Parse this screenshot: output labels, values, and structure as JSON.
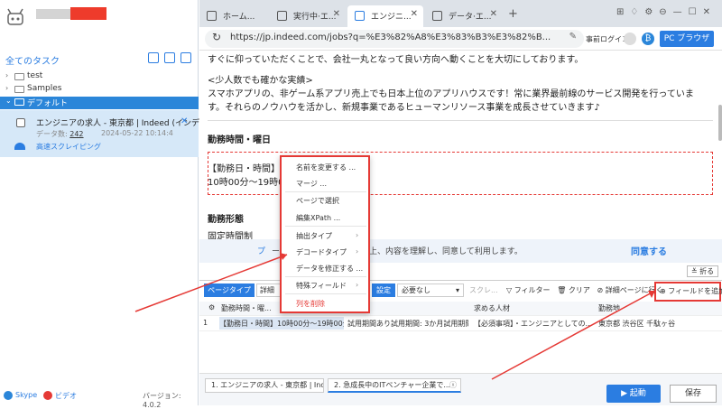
{
  "app": {
    "version": "バージョン: 4.0.2",
    "all_tasks": "全てのタスク"
  },
  "tree": [
    {
      "label": "test"
    },
    {
      "label": "Samples"
    },
    {
      "label": "デフォルト"
    }
  ],
  "task": {
    "name": "エンジニアの求人 - 東京都 | Indeed (インデ...",
    "count_label": "データ数:",
    "count": "242",
    "date": "2024-05-22 10:14:4",
    "speed": "高速スクレイピング"
  },
  "footer": {
    "skype": "Skype",
    "video": "ビデオ"
  },
  "tabs": [
    {
      "label": "ホーム..."
    },
    {
      "label": "実行中·エ..."
    },
    {
      "label": "エンジニ..."
    },
    {
      "label": "データ·エ..."
    }
  ],
  "address": {
    "url": "https://jp.indeed.com/jobs?q=%E3%82%A8%E3%83%B3%E3%82%B...",
    "prelogin": "事前ログイン",
    "browser": "PC ブラウザ"
  },
  "page": {
    "line1": "すぐに仰っていただくことで、会社一丸となって良い方向へ動くことを大切にしております。",
    "line2": "<少人数でも確かな実績>",
    "line3": "スマホアプリの、非ゲーム系アプリ売上でも日本上位のアプリハウスです！常に業界最前線のサービス開発を行っていま",
    "line4": "す。それらのノウハウを活かし、新規事業であるヒューマンリソース事業を成長させていきます♪",
    "sec1": "勤務時間・曜日",
    "sel1": "【勤務日・時間】",
    "sel2": "10時00分〜19時0",
    "sec2": "勤務形態",
    "sec3": "固定時間制",
    "agree_prefix": "プ",
    "agree_text": "ーおよび利用規約を閲覧の上、内容を理解し、同意して利用します。",
    "agree_btn": "同意する"
  },
  "ctx": [
    "名前を変更する ...",
    "マージ ...",
    "ページで選択",
    "編集XPath ...",
    "抽出タイプ",
    "デコードタイプ",
    "データを修正する ...",
    "特殊フィールド",
    "列を削除"
  ],
  "toolbar": {
    "page_type": "ページタイプ",
    "detail": "詳細",
    "set": "設定",
    "need": "必要なし",
    "scroll": "スクレ...",
    "filter": "フィルター",
    "clear": "クリア",
    "detail_page": "詳細ページに行く",
    "add_field": "フィールドを追加",
    "fold": "折る"
  },
  "table": {
    "headers": [
      "",
      "勤務時間・曜...",
      "間",
      "求める人材",
      "勤務地"
    ],
    "rows": [
      [
        "1",
        "【勤務日・時間】10時00分〜19時00分",
        "試用期間あり試用期間: 3か月試用期間...",
        "【必須事項】・エンジニアとしての...",
        "東京都 渋谷区 千駄ヶ谷"
      ]
    ]
  },
  "bottom": {
    "tabs": [
      "1. エンジニアの求人 - 東京都 | Ind...",
      "2. 急成長中のITベンチャー企業で..."
    ],
    "start": "▶  起動",
    "save": "保存"
  }
}
